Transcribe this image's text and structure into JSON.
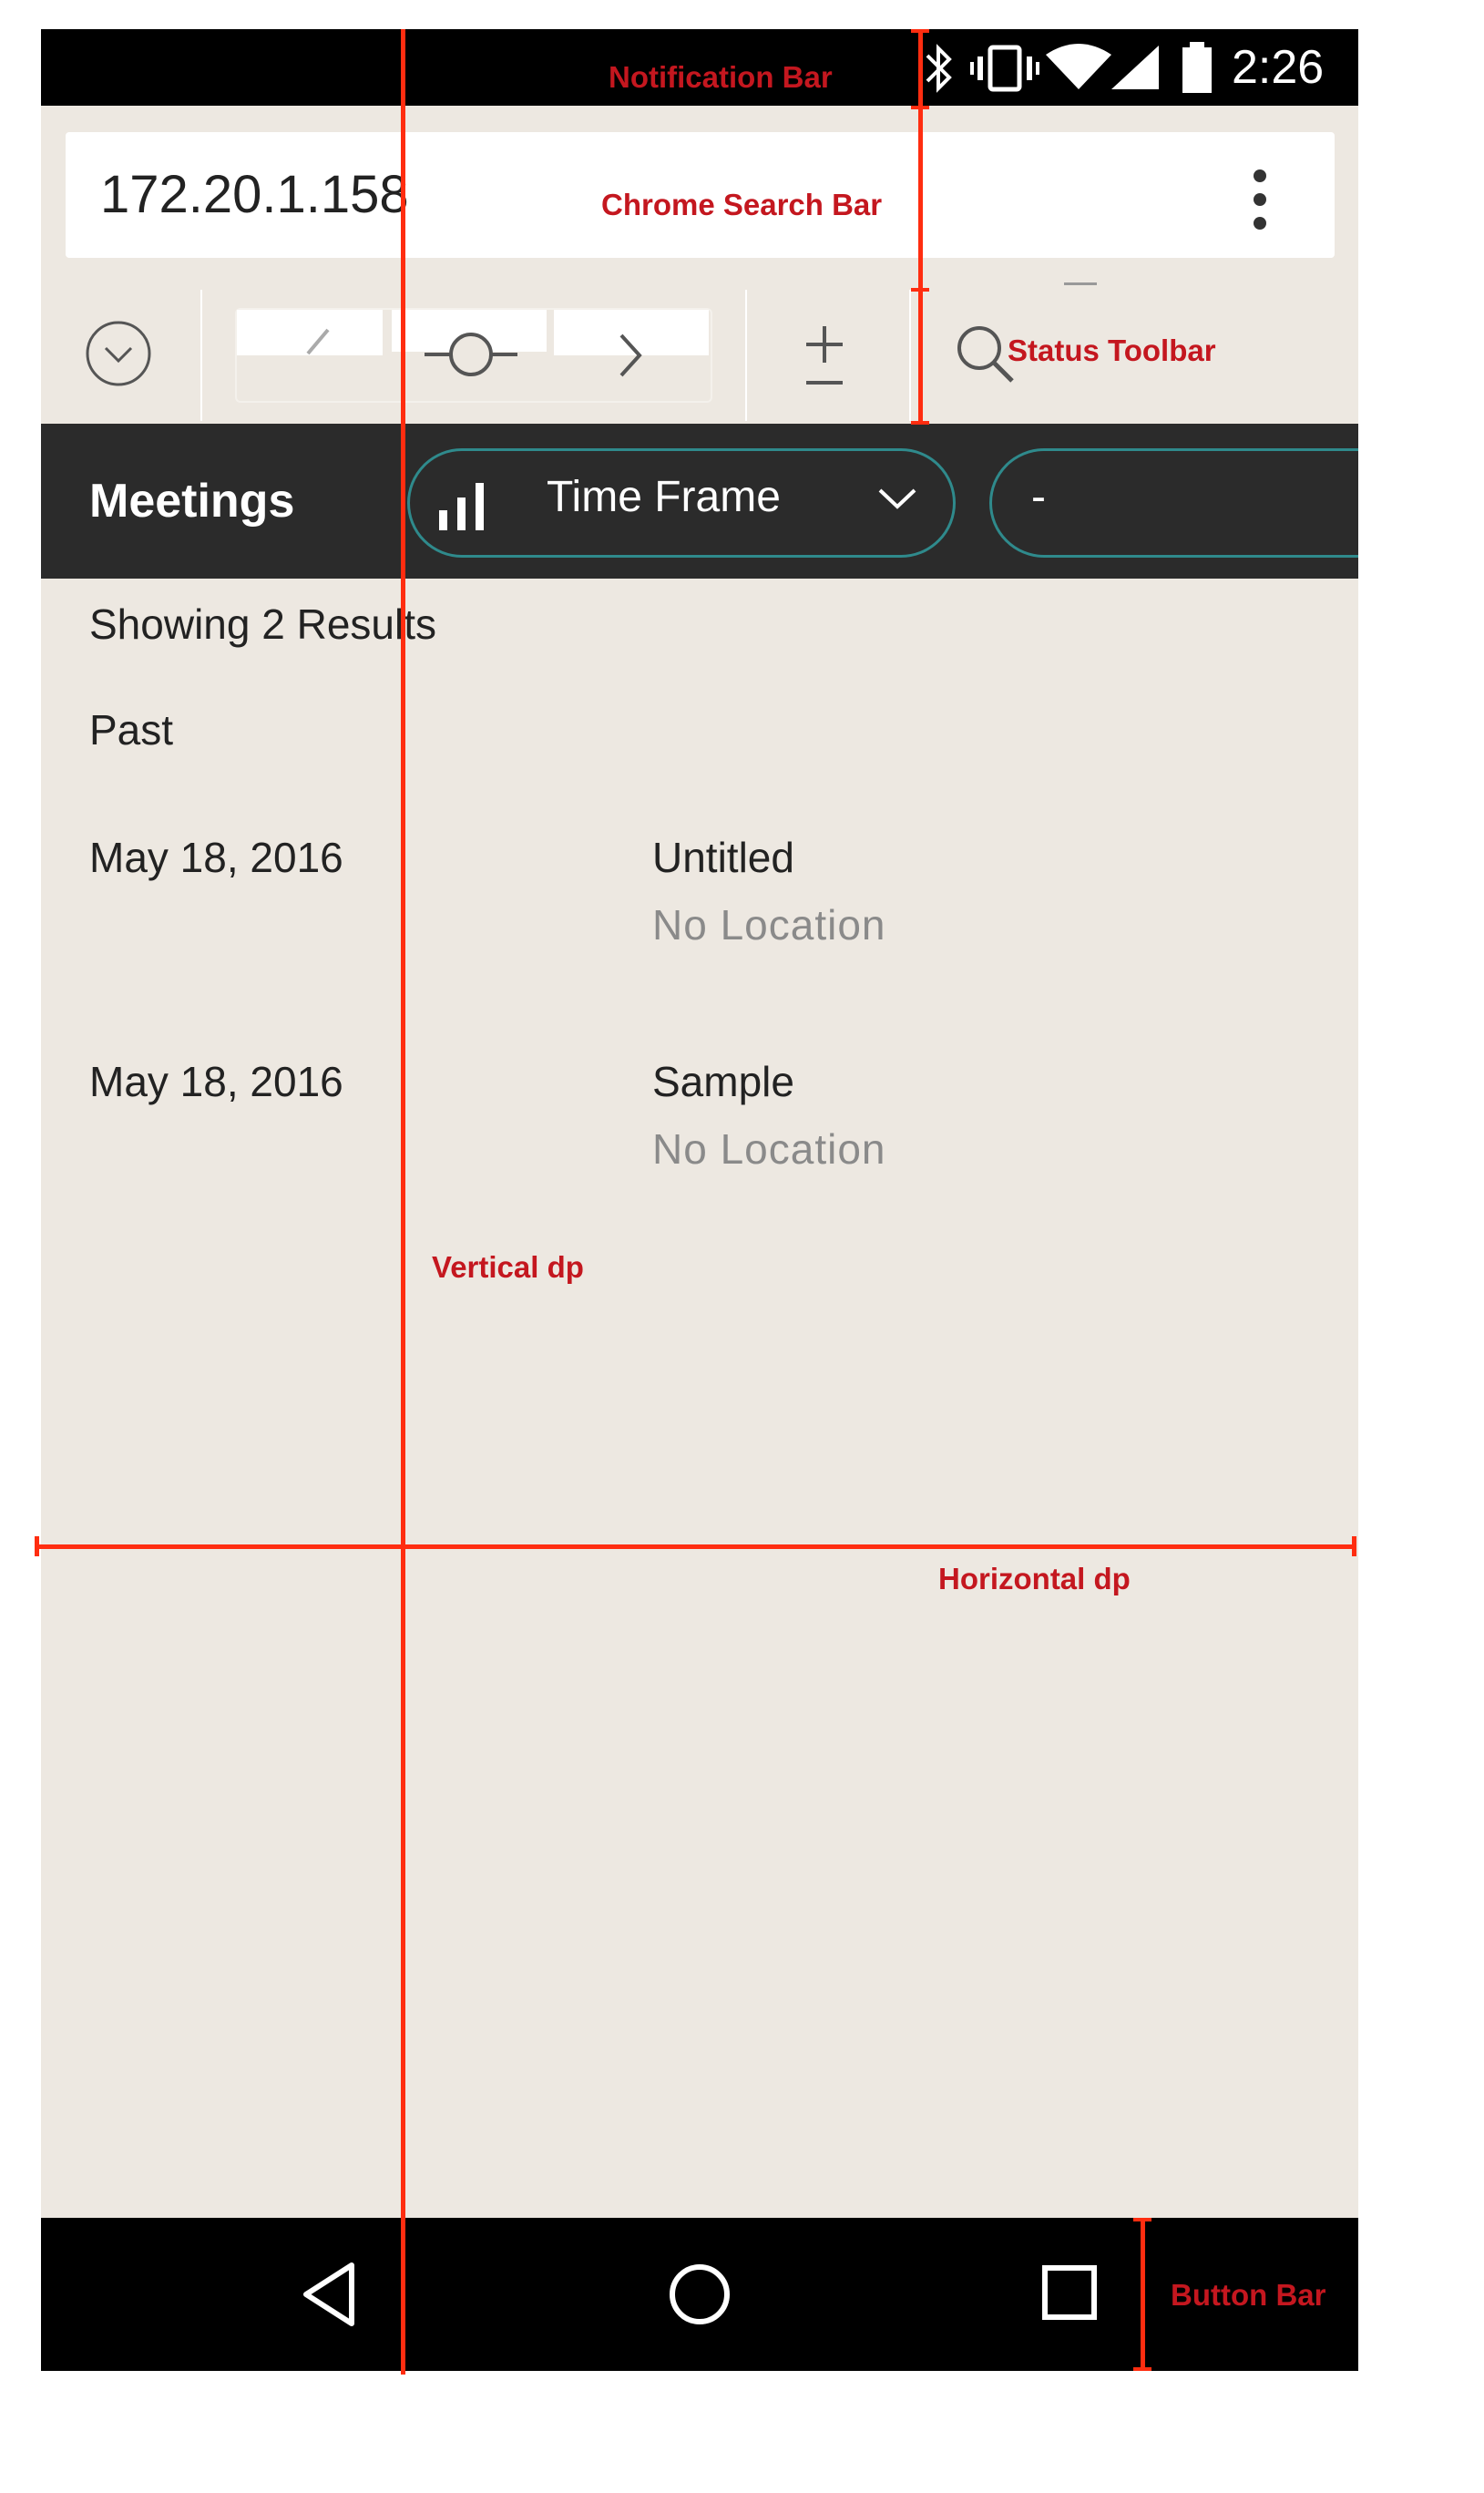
{
  "status_bar": {
    "time": "2:26",
    "icons": [
      "bluetooth-icon",
      "vibrate-icon",
      "wifi-icon",
      "signal-icon",
      "battery-icon"
    ]
  },
  "chrome": {
    "url": "172.20.1.158",
    "menu_icon": "kebab-menu-icon"
  },
  "toolbar": {
    "icons": [
      "collapse-circle-icon",
      "back-chevron-icon",
      "zoom-slider-icon",
      "forward-chevron-icon",
      "plus-minus-icon",
      "search-icon"
    ]
  },
  "header": {
    "title": "Meetings",
    "filter_label": "Time Frame",
    "second_filter_label": "-",
    "accent_color": "#2f8a8c"
  },
  "results": {
    "summary": "Showing 2 Results",
    "section": "Past",
    "meetings": [
      {
        "date": "May 18, 2016",
        "name": "Untitled",
        "location": "No Location"
      },
      {
        "date": "May 18, 2016",
        "name": "Sample",
        "location": "No Location"
      }
    ]
  },
  "annotations": {
    "notification_bar": "Notification Bar",
    "chrome_search_bar": "Chrome Search Bar",
    "status_toolbar": "Status Toolbar",
    "vertical_dp": "Vertical dp",
    "horizontal_dp": "Horizontal dp",
    "button_bar": "Button Bar",
    "color": "#c4171f"
  }
}
